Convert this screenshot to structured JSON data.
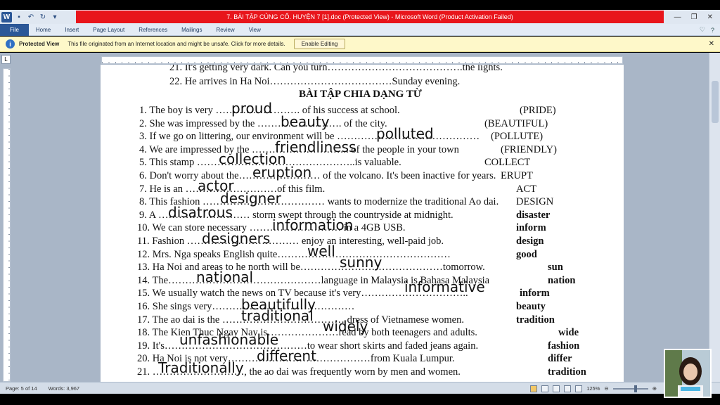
{
  "window": {
    "title": "7. BÀI TẬP CỦNG CỐ. HUYỆN 7 [1].doc (Protected View) - Microsoft Word (Product Activation Failed)"
  },
  "ribbon": {
    "tabs": [
      "File",
      "Home",
      "Insert",
      "Page Layout",
      "References",
      "Mailings",
      "Review",
      "View"
    ]
  },
  "message_bar": {
    "title": "Protected View",
    "text": "This file originated from an Internet location and might be unsafe. Click for more details.",
    "button": "Enable Editing"
  },
  "document": {
    "top_lines": [
      "21. It's getting very dark. Can you turn………………………………….the lights.",
      "22. He arrives in Ha Noi………………………………Sunday evening."
    ],
    "heading": "BÀI TẬP CHIA DẠNG TỪ",
    "lines": [
      "1. The boy is very ……………………. of his success at school.",
      "2. She was impressed by the ……………………. of the city.",
      "3. If we go on littering, our environment will be ……………………………………",
      "4. We are impressed by the ……………………….. of the people in your town",
      "5. This stamp ………………………………………..is valuable.",
      "6. Don't worry about the…………………… of the volcano. It's been inactive for years.",
      "7. He is an ………………………of this film.",
      "8. This fashion ……………………………… wants to modernize the traditional Ao dai.",
      "9. A ……………………… storm swept through the countryside at midnight.",
      "10. We can store necessary ……………………… in a 4GB USB.",
      "11. Fashion …………………………… enjoy an interesting, well-paid job.",
      "12. Mrs. Nga speaks English quite……………………………………………",
      "13. Ha Noi and areas to he north will be……………………………………tomorrow.",
      "14. The………………………………………language in Malaysia is Bahasa Malaysia",
      "15. We usually watch the news on TV because it's very…………………………..",
      "16. She sings very……………………………………",
      "17. The ao dai is the ……………………………… dress of Vietnamese women.",
      "18. The Kien Thuc Ngay Nay is…………………read by both teenagers and adults.",
      "19. It's……………………………………to wear short skirts and faded jeans again.",
      "20. Ha Noi is not very……………………………………from Kuala Lumpur.",
      "21. ………………………, the ao dai was frequently worn by men and women."
    ],
    "base_words": [
      "(PRIDE)",
      "(BEAUTIFUL)",
      "(POLLUTE)",
      "(FRIENDLY)",
      "COLLECT",
      "ERUPT",
      "ACT",
      "DESIGN",
      "disaster",
      "inform",
      "design",
      "good",
      "sun",
      "nation",
      "inform",
      "beauty",
      "tradition",
      "wide",
      "fashion",
      "differ",
      "tradition"
    ],
    "answers": [
      "proud",
      "beauty",
      "polluted",
      "friendliness",
      "collection",
      "eruption",
      "actor",
      "designer",
      "disatrous",
      "information",
      "designers",
      "well",
      "sunny",
      "national",
      "informative",
      "beautifully",
      "traditional",
      "widely",
      "unfashionable",
      "different",
      "Traditionally"
    ]
  },
  "statusbar": {
    "page": "Page: 5 of 14",
    "words": "Words: 3,967",
    "zoom": "125%"
  },
  "colors": {
    "title_strip": "#e8151b",
    "file_tab": "#2b5797",
    "message_bar": "#fef8c9"
  }
}
